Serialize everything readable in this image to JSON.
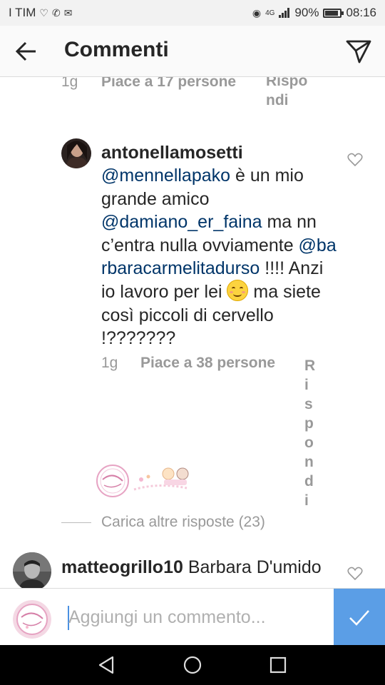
{
  "status_bar": {
    "carrier": "I TIM",
    "network": "4G",
    "battery_text": "90%",
    "battery_level": 0.9,
    "time": "08:16"
  },
  "header": {
    "title": "Commenti",
    "back_icon": "arrow-left-icon",
    "send_icon": "paper-plane-icon"
  },
  "top_comment_meta": {
    "time": "1g",
    "likes": "Piace a 17 persone",
    "reply": "Rispondi"
  },
  "reply_comment": {
    "username": "antonellamosetti",
    "mention1": "@mennellapako",
    "text1": " è un mio grande amico ",
    "mention2": "@damiano_er_faina",
    "text2": " ma nn c’entra nulla ovviamente ",
    "mention3": "@barbaracarmelitadurso",
    "text3": " !!!! Anzi io lavoro per lei ",
    "emoji": "smiling-face-icon",
    "text4": " ma siete così piccoli di cervello !???????",
    "time": "1g",
    "likes": "Piace a 38 persone",
    "reply": "Rispondi"
  },
  "load_more": "Carica altre risposte (23)",
  "bottom_comment": {
    "username": "matteogrillo10",
    "text": " Barbara D'umido"
  },
  "input": {
    "placeholder": "Aggiungi un commento..."
  },
  "colors": {
    "mention": "#003569",
    "meta": "#999999",
    "post_button": "#5b9ee6"
  }
}
